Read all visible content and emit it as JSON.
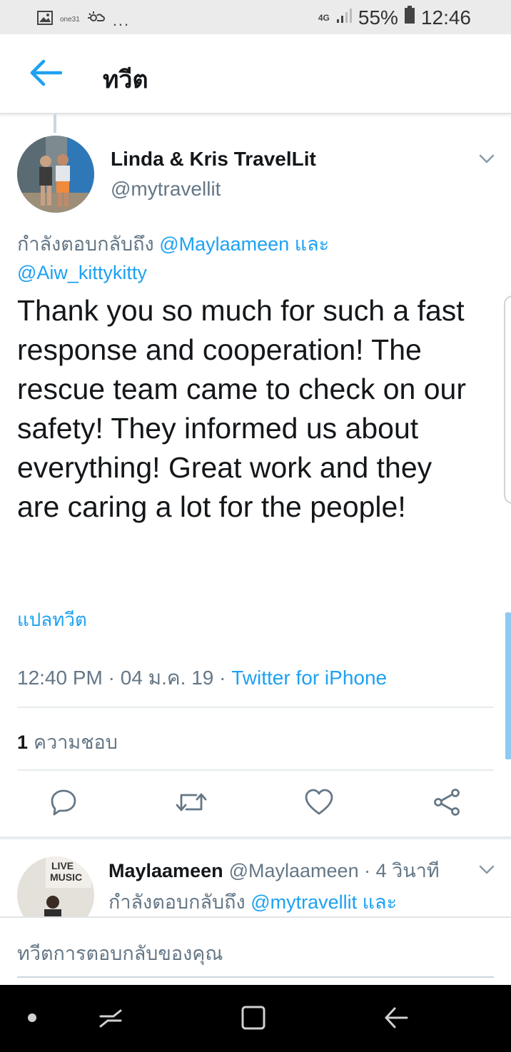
{
  "status_bar": {
    "carrier_small": "one31",
    "dots": "...",
    "network": "4G",
    "battery": "55%",
    "time": "12:46"
  },
  "header": {
    "title": "ทวีต",
    "back_icon": "arrow-left-icon"
  },
  "tweet": {
    "display_name": "Linda & Kris TravelLit",
    "handle": "@mytravellit",
    "reply_prefix": "กำลังตอบกลับถึง",
    "reply_mention_1": "@Maylaameen",
    "reply_conjunction": "และ",
    "reply_mention_2": "@Aiw_kittykitty",
    "text": "Thank you so much for such a fast response and cooperation! The rescue team came to check on our safety! They informed us about everything! Great work and they are caring a lot for the people!",
    "translate_label": "แปลทวีต",
    "time": "12:40 PM",
    "date": "04 ม.ค. 19",
    "separator": "·",
    "source": "Twitter for iPhone",
    "likes_count": "1",
    "likes_label": "ความชอบ"
  },
  "actions": {
    "reply_icon": "reply-icon",
    "retweet_icon": "retweet-icon",
    "like_icon": "heart-icon",
    "share_icon": "share-icon"
  },
  "reply_preview": {
    "display_name": "Maylaameen",
    "handle": "@Maylaameen",
    "separator": "·",
    "time_ago": "4 วินาที",
    "reply_prefix": "กำลังตอบกลับถึง",
    "reply_mention": "@mytravellit",
    "reply_conjunction": "และ",
    "avatar_text_1": "LIVE",
    "avatar_text_2": "MUSIC"
  },
  "compose": {
    "placeholder": "ทวีตการตอบกลับของคุณ"
  },
  "colors": {
    "accent": "#1da1f2",
    "secondary_text": "#657786",
    "primary_text": "#14171a",
    "divider": "#e6ecf0"
  }
}
